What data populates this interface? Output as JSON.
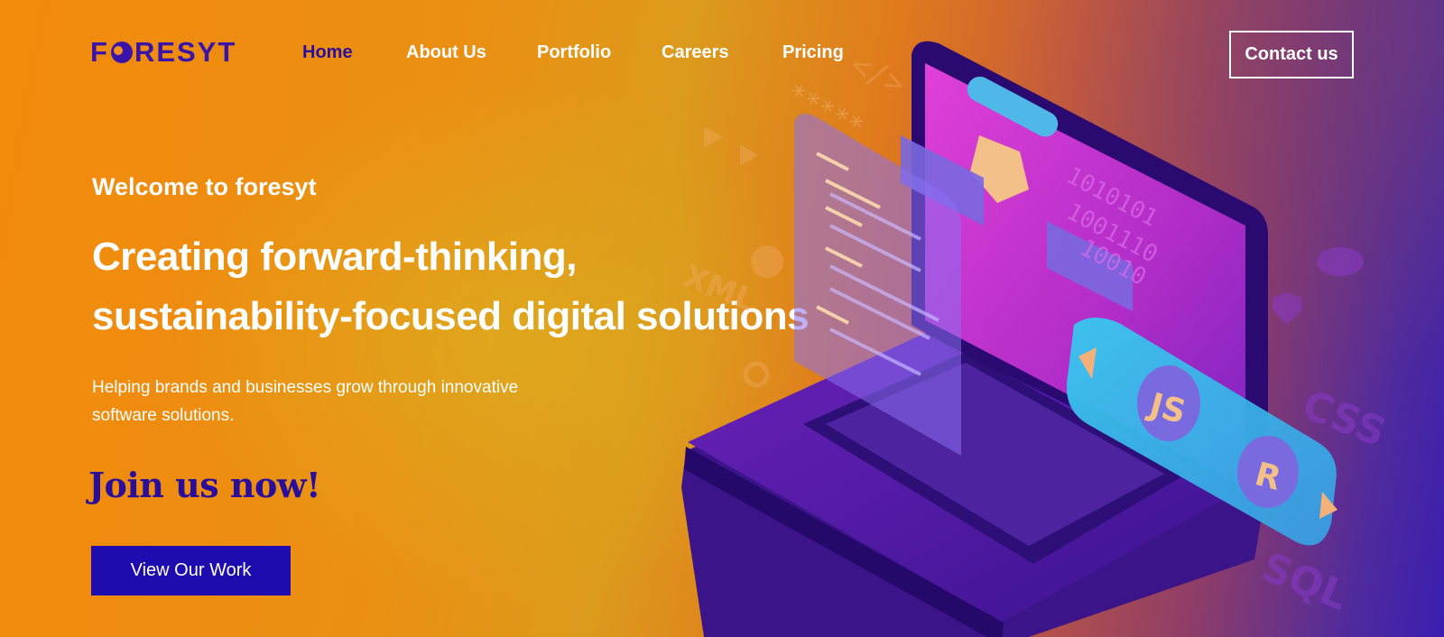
{
  "header": {
    "logo_text": [
      "F",
      "RESYT"
    ],
    "nav": [
      {
        "label": "Home",
        "active": true
      },
      {
        "label": "About Us",
        "active": false
      },
      {
        "label": "Portfolio",
        "active": false
      },
      {
        "label": "Careers",
        "active": false
      },
      {
        "label": "Pricing",
        "active": false
      }
    ],
    "contact_label": "Contact us"
  },
  "hero": {
    "welcome": "Welcome to foresyt",
    "headline_line1": "Creating forward-thinking,",
    "headline_line2": "sustainability-focused digital solutions",
    "subtext_line1": "Helping brands and businesses grow through innovative",
    "subtext_line2": "software solutions.",
    "join": "Join us now!",
    "cta_label": "View Our Work"
  },
  "illustration": {
    "labels": [
      "JS",
      "R",
      "CSS",
      "SQL",
      "XML",
      "</>",
      "*****"
    ]
  },
  "colors": {
    "brand_primary": "#2a0e9a",
    "cta": "#1e0cb0",
    "orange": "#f28a0c"
  }
}
